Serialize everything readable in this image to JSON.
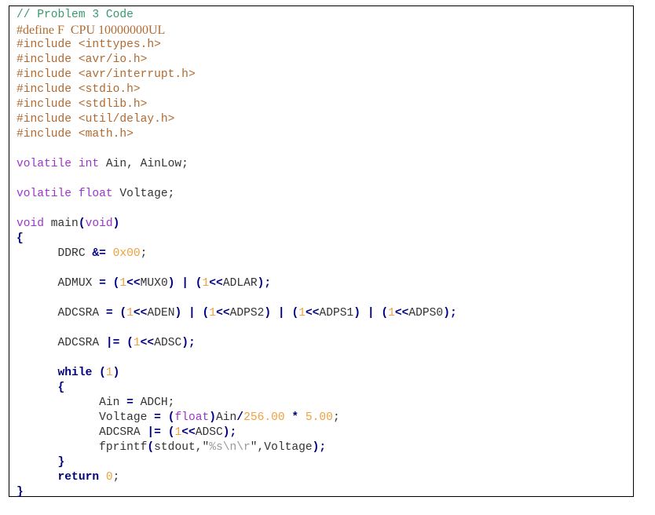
{
  "document": {
    "title_comment": "// Problem 3 Code",
    "lines": [
      {
        "indent": "",
        "tokens": [
          {
            "t": "// Problem 3 Code",
            "c": "cm"
          }
        ]
      },
      {
        "indent": "",
        "tokens": [
          {
            "t": "#define F  CPU 10000000UL",
            "c": "ppd"
          }
        ]
      },
      {
        "indent": "",
        "tokens": [
          {
            "t": "#include <inttypes.h>",
            "c": "pp"
          }
        ]
      },
      {
        "indent": "",
        "tokens": [
          {
            "t": "#include <avr/io.h>",
            "c": "pp"
          }
        ]
      },
      {
        "indent": "",
        "tokens": [
          {
            "t": "#include <avr/interrupt.h>",
            "c": "pp"
          }
        ]
      },
      {
        "indent": "",
        "tokens": [
          {
            "t": "#include <stdio.h>",
            "c": "pp"
          }
        ]
      },
      {
        "indent": "",
        "tokens": [
          {
            "t": "#include <stdlib.h>",
            "c": "pp"
          }
        ]
      },
      {
        "indent": "",
        "tokens": [
          {
            "t": "#include <util/delay.h>",
            "c": "pp"
          }
        ]
      },
      {
        "indent": "",
        "tokens": [
          {
            "t": "#include <math.h>",
            "c": "pp"
          }
        ]
      },
      {
        "indent": "",
        "tokens": []
      },
      {
        "indent": "",
        "tokens": [
          {
            "t": "volatile int",
            "c": "kw"
          },
          {
            "t": " Ain, AinLow;",
            "c": ""
          }
        ]
      },
      {
        "indent": "",
        "tokens": []
      },
      {
        "indent": "",
        "tokens": [
          {
            "t": "volatile float",
            "c": "kw"
          },
          {
            "t": " Voltage;",
            "c": ""
          }
        ]
      },
      {
        "indent": "",
        "tokens": []
      },
      {
        "indent": "",
        "tokens": [
          {
            "t": "void",
            "c": "kw"
          },
          {
            "t": " main",
            "c": ""
          },
          {
            "t": "(",
            "c": "op"
          },
          {
            "t": "void",
            "c": "kw"
          },
          {
            "t": ")",
            "c": "op"
          }
        ]
      },
      {
        "indent": "",
        "tokens": [
          {
            "t": "{",
            "c": "op"
          }
        ]
      },
      {
        "indent": "      ",
        "tokens": [
          {
            "t": "DDRC ",
            "c": ""
          },
          {
            "t": "&=",
            "c": "op"
          },
          {
            "t": " ",
            "c": ""
          },
          {
            "t": "0x00",
            "c": "num"
          },
          {
            "t": ";",
            "c": ""
          }
        ]
      },
      {
        "indent": "",
        "tokens": []
      },
      {
        "indent": "      ",
        "tokens": [
          {
            "t": "ADMUX ",
            "c": ""
          },
          {
            "t": "=",
            "c": "op"
          },
          {
            "t": " ",
            "c": ""
          },
          {
            "t": "(",
            "c": "op"
          },
          {
            "t": "1",
            "c": "num"
          },
          {
            "t": "<<",
            "c": "op"
          },
          {
            "t": "MUX0",
            "c": ""
          },
          {
            "t": ")",
            "c": "op"
          },
          {
            "t": " ",
            "c": ""
          },
          {
            "t": "|",
            "c": "op"
          },
          {
            "t": " ",
            "c": ""
          },
          {
            "t": "(",
            "c": "op"
          },
          {
            "t": "1",
            "c": "num"
          },
          {
            "t": "<<",
            "c": "op"
          },
          {
            "t": "ADLAR",
            "c": ""
          },
          {
            "t": ");",
            "c": "op"
          }
        ]
      },
      {
        "indent": "",
        "tokens": []
      },
      {
        "indent": "      ",
        "tokens": [
          {
            "t": "ADCSRA ",
            "c": ""
          },
          {
            "t": "=",
            "c": "op"
          },
          {
            "t": " ",
            "c": ""
          },
          {
            "t": "(",
            "c": "op"
          },
          {
            "t": "1",
            "c": "num"
          },
          {
            "t": "<<",
            "c": "op"
          },
          {
            "t": "ADEN",
            "c": ""
          },
          {
            "t": ")",
            "c": "op"
          },
          {
            "t": " ",
            "c": ""
          },
          {
            "t": "|",
            "c": "op"
          },
          {
            "t": " ",
            "c": ""
          },
          {
            "t": "(",
            "c": "op"
          },
          {
            "t": "1",
            "c": "num"
          },
          {
            "t": "<<",
            "c": "op"
          },
          {
            "t": "ADPS2",
            "c": ""
          },
          {
            "t": ")",
            "c": "op"
          },
          {
            "t": " ",
            "c": ""
          },
          {
            "t": "|",
            "c": "op"
          },
          {
            "t": " ",
            "c": ""
          },
          {
            "t": "(",
            "c": "op"
          },
          {
            "t": "1",
            "c": "num"
          },
          {
            "t": "<<",
            "c": "op"
          },
          {
            "t": "ADPS1",
            "c": ""
          },
          {
            "t": ")",
            "c": "op"
          },
          {
            "t": " ",
            "c": ""
          },
          {
            "t": "|",
            "c": "op"
          },
          {
            "t": " ",
            "c": ""
          },
          {
            "t": "(",
            "c": "op"
          },
          {
            "t": "1",
            "c": "num"
          },
          {
            "t": "<<",
            "c": "op"
          },
          {
            "t": "ADPS0",
            "c": ""
          },
          {
            "t": ");",
            "c": "op"
          }
        ]
      },
      {
        "indent": "",
        "tokens": []
      },
      {
        "indent": "      ",
        "tokens": [
          {
            "t": "ADCSRA ",
            "c": ""
          },
          {
            "t": "|=",
            "c": "op"
          },
          {
            "t": " ",
            "c": ""
          },
          {
            "t": "(",
            "c": "op"
          },
          {
            "t": "1",
            "c": "num"
          },
          {
            "t": "<<",
            "c": "op"
          },
          {
            "t": "ADSC",
            "c": ""
          },
          {
            "t": ");",
            "c": "op"
          }
        ]
      },
      {
        "indent": "",
        "tokens": []
      },
      {
        "indent": "      ",
        "tokens": [
          {
            "t": "while",
            "c": "kwb"
          },
          {
            "t": " ",
            "c": ""
          },
          {
            "t": "(",
            "c": "op"
          },
          {
            "t": "1",
            "c": "num"
          },
          {
            "t": ")",
            "c": "op"
          }
        ]
      },
      {
        "indent": "      ",
        "tokens": [
          {
            "t": "{",
            "c": "op"
          }
        ]
      },
      {
        "indent": "            ",
        "tokens": [
          {
            "t": "Ain ",
            "c": ""
          },
          {
            "t": "=",
            "c": "op"
          },
          {
            "t": " ADCH;",
            "c": ""
          }
        ]
      },
      {
        "indent": "            ",
        "tokens": [
          {
            "t": "Voltage ",
            "c": ""
          },
          {
            "t": "=",
            "c": "op"
          },
          {
            "t": " ",
            "c": ""
          },
          {
            "t": "(",
            "c": "op"
          },
          {
            "t": "float",
            "c": "kw"
          },
          {
            "t": ")",
            "c": "op"
          },
          {
            "t": "Ain",
            "c": ""
          },
          {
            "t": "/",
            "c": "op"
          },
          {
            "t": "256.00",
            "c": "num"
          },
          {
            "t": " ",
            "c": ""
          },
          {
            "t": "*",
            "c": "op"
          },
          {
            "t": " ",
            "c": ""
          },
          {
            "t": "5.00",
            "c": "num"
          },
          {
            "t": ";",
            "c": ""
          }
        ]
      },
      {
        "indent": "            ",
        "tokens": [
          {
            "t": "ADCSRA ",
            "c": ""
          },
          {
            "t": "|=",
            "c": "op"
          },
          {
            "t": " ",
            "c": ""
          },
          {
            "t": "(",
            "c": "op"
          },
          {
            "t": "1",
            "c": "num"
          },
          {
            "t": "<<",
            "c": "op"
          },
          {
            "t": "ADSC",
            "c": ""
          },
          {
            "t": ");",
            "c": "op"
          }
        ]
      },
      {
        "indent": "            ",
        "tokens": [
          {
            "t": "fprintf",
            "c": ""
          },
          {
            "t": "(",
            "c": "op"
          },
          {
            "t": "stdout,",
            "c": ""
          },
          {
            "t": "\"",
            "c": ""
          },
          {
            "t": "%s\\n\\r",
            "c": "str"
          },
          {
            "t": "\",Voltage",
            "c": ""
          },
          {
            "t": ");",
            "c": "op"
          }
        ]
      },
      {
        "indent": "      ",
        "tokens": [
          {
            "t": "}",
            "c": "op"
          }
        ]
      },
      {
        "indent": "      ",
        "tokens": [
          {
            "t": "return",
            "c": "kwb"
          },
          {
            "t": " ",
            "c": ""
          },
          {
            "t": "0",
            "c": "num"
          },
          {
            "t": ";",
            "c": ""
          }
        ]
      },
      {
        "indent": "",
        "tokens": [
          {
            "t": "}",
            "c": "op"
          }
        ]
      }
    ]
  }
}
